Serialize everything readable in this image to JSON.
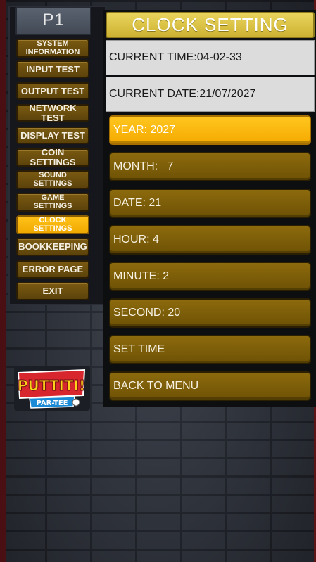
{
  "player": {
    "label": "P1"
  },
  "menu": {
    "items": [
      {
        "lines": [
          "SYSTEM",
          "INFORMATION"
        ],
        "active": false
      },
      {
        "lines": [
          "INPUT TEST"
        ],
        "active": false
      },
      {
        "lines": [
          "OUTPUT TEST"
        ],
        "active": false
      },
      {
        "lines": [
          "NETWORK TEST"
        ],
        "active": false
      },
      {
        "lines": [
          "DISPLAY TEST"
        ],
        "active": false
      },
      {
        "lines": [
          "COIN SETTINGS"
        ],
        "active": false
      },
      {
        "lines": [
          "SOUND",
          "SETTINGS"
        ],
        "active": false
      },
      {
        "lines": [
          "GAME",
          "SETTINGS"
        ],
        "active": false
      },
      {
        "lines": [
          "CLOCK",
          "SETTINGS"
        ],
        "active": true
      },
      {
        "lines": [
          "BOOKKEEPING"
        ],
        "active": false
      },
      {
        "lines": [
          "ERROR PAGE"
        ],
        "active": false
      },
      {
        "lines": [
          "EXIT"
        ],
        "active": false
      }
    ]
  },
  "logo": {
    "text": "PUTTITI! PAR-TEE"
  },
  "clock": {
    "title": "CLOCK SETTING",
    "current_time": "CURRENT TIME:04-02-33",
    "current_date": "CURRENT DATE:21/07/2027",
    "fields": [
      {
        "label": "YEAR: 2027",
        "active": true
      },
      {
        "label": "MONTH:   7",
        "active": false
      },
      {
        "label": "DATE: 21",
        "active": false
      },
      {
        "label": "HOUR: 4",
        "active": false
      },
      {
        "label": "MINUTE: 2",
        "active": false
      },
      {
        "label": "SECOND: 20",
        "active": false
      },
      {
        "label": "SET TIME",
        "active": false
      },
      {
        "label": "BACK TO MENU",
        "active": false
      }
    ]
  },
  "colors": {
    "accent_gold": "#f5aa00",
    "button_brown": "#7a5a12",
    "title_yellow": "#dcc445",
    "info_grey": "#dcdcdc"
  }
}
